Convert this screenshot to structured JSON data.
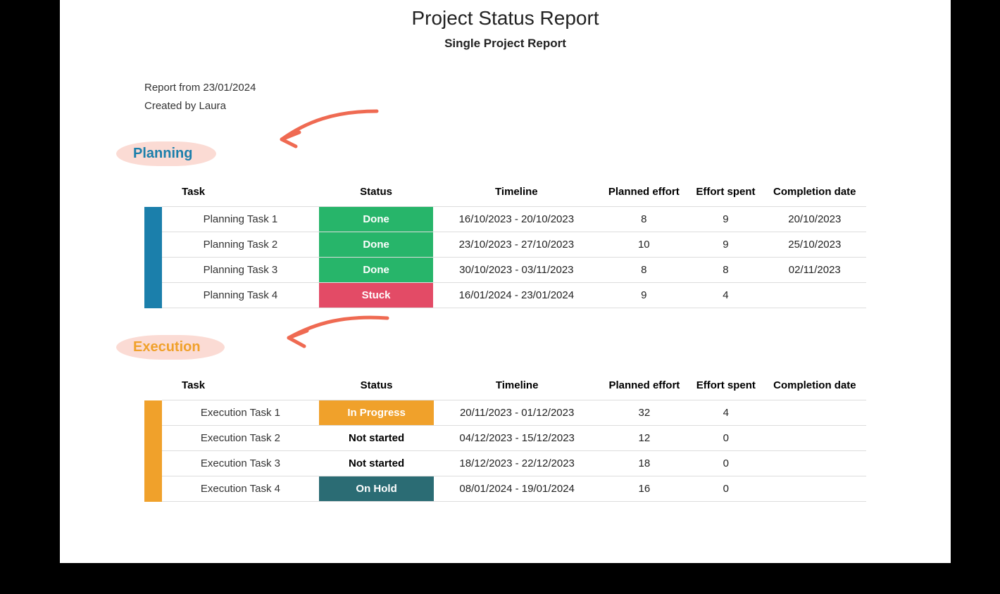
{
  "title": "Project Status Report",
  "subtitle": "Single Project Report",
  "report_from_line": "Report from 23/01/2024",
  "created_by_line": "Created by Laura",
  "columns": {
    "task": "Task",
    "status": "Status",
    "timeline": "Timeline",
    "planned_effort": "Planned effort",
    "effort_spent": "Effort spent",
    "completion_date": "Completion date"
  },
  "sections": [
    {
      "name": "Planning",
      "color": "blue",
      "rows": [
        {
          "task": "Planning Task 1",
          "status": "Done",
          "status_class": "done pill",
          "timeline": "16/10/2023 - 20/10/2023",
          "planned_effort": "8",
          "effort_spent": "9",
          "completion_date": "20/10/2023"
        },
        {
          "task": "Planning Task 2",
          "status": "Done",
          "status_class": "done pill",
          "timeline": "23/10/2023 - 27/10/2023",
          "planned_effort": "10",
          "effort_spent": "9",
          "completion_date": "25/10/2023"
        },
        {
          "task": "Planning Task 3",
          "status": "Done",
          "status_class": "done pill",
          "timeline": "30/10/2023 - 03/11/2023",
          "planned_effort": "8",
          "effort_spent": "8",
          "completion_date": "02/11/2023"
        },
        {
          "task": "Planning Task 4",
          "status": "Stuck",
          "status_class": "stuck pill",
          "timeline": "16/01/2024 - 23/01/2024",
          "planned_effort": "9",
          "effort_spent": "4",
          "completion_date": ""
        }
      ]
    },
    {
      "name": "Execution",
      "color": "orange",
      "rows": [
        {
          "task": "Execution Task 1",
          "status": "In Progress",
          "status_class": "inprogress pill",
          "timeline": "20/11/2023 - 01/12/2023",
          "planned_effort": "32",
          "effort_spent": "4",
          "completion_date": ""
        },
        {
          "task": "Execution Task 2",
          "status": "Not started",
          "status_class": "",
          "timeline": "04/12/2023 - 15/12/2023",
          "planned_effort": "12",
          "effort_spent": "0",
          "completion_date": ""
        },
        {
          "task": "Execution Task 3",
          "status": "Not started",
          "status_class": "",
          "timeline": "18/12/2023 - 22/12/2023",
          "planned_effort": "18",
          "effort_spent": "0",
          "completion_date": ""
        },
        {
          "task": "Execution Task 4",
          "status": "On Hold",
          "status_class": "onhold pill",
          "timeline": "08/01/2024 - 19/01/2024",
          "planned_effort": "16",
          "effort_spent": "0",
          "completion_date": ""
        }
      ]
    }
  ]
}
